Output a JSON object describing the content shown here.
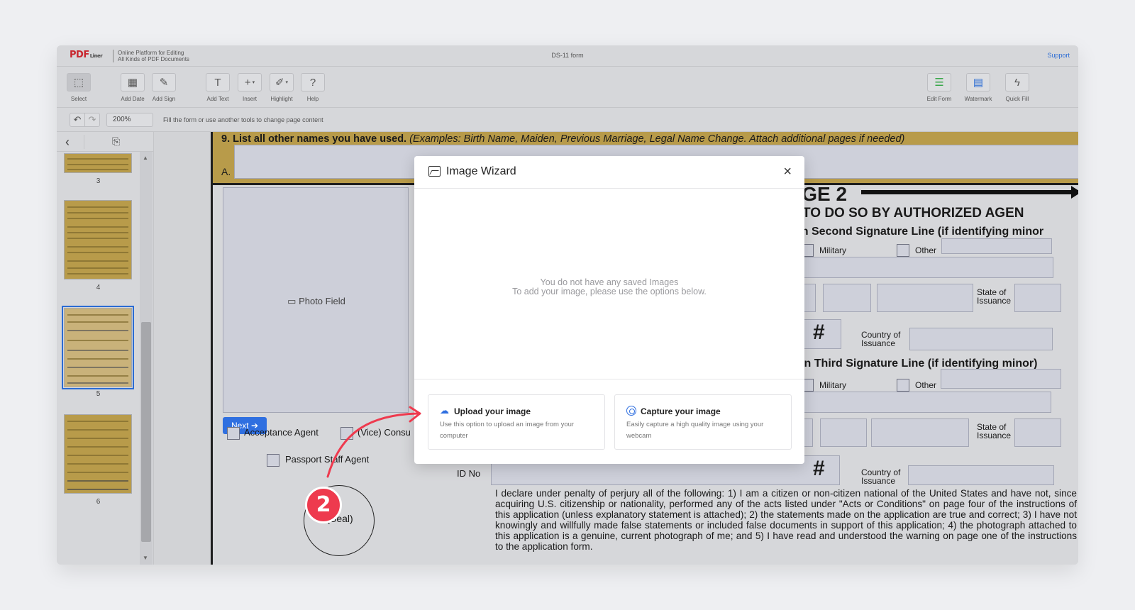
{
  "header": {
    "logo_main": "PDF",
    "logo_sub": "Liner",
    "tagline_line1": "Online Platform for Editing",
    "tagline_line2": "All Kinds of PDF Documents",
    "document_title": "DS-11 form",
    "support_link": "Support"
  },
  "toolbar": {
    "left_tools": [
      {
        "label": "Select",
        "icon": "select-cursor-icon"
      },
      {
        "label": "Add Date",
        "icon": "calendar-icon"
      },
      {
        "label": "Add Sign",
        "icon": "signature-pen-icon"
      },
      {
        "label": "Add Text",
        "icon": "text-t-icon"
      },
      {
        "label": "Insert",
        "icon": "plus-icon"
      },
      {
        "label": "Highlight",
        "icon": "highlighter-icon"
      },
      {
        "label": "Help",
        "icon": "question-icon"
      }
    ],
    "right_tools": [
      {
        "label": "Edit Form",
        "icon": "edit-form-icon"
      },
      {
        "label": "Watermark",
        "icon": "watermark-icon"
      },
      {
        "label": "Quick Fill",
        "icon": "lightning-icon"
      }
    ]
  },
  "subbar": {
    "zoom": "200%",
    "hint": "Fill the form or use another tools to change page content"
  },
  "sidebar": {
    "pages": [
      {
        "number": "3"
      },
      {
        "number": "4"
      },
      {
        "number": "5",
        "selected": true
      },
      {
        "number": "6"
      }
    ]
  },
  "document": {
    "q9_bold": "9.  List all other names you have used.",
    "q9_italic": " (Examples: Birth Name, Maiden, Previous Marriage, Legal Name Change.  Attach additional  pages if needed)",
    "row_a_label": "A.",
    "photo_field": "Photo Field",
    "next_button": "Next ➔",
    "acceptance_agent": "Acceptance Agent",
    "vice_consul": "(Vice) Consu",
    "passport_staff_agent": "Passport Staff Agent",
    "seal": "(Seal)",
    "page2_heading": "AGE 2",
    "authorized_agent": "D TO DO SO BY AUTHORIZED AGEN",
    "second_signature": "on Second Signature Line (if identifying minor",
    "third_signature": "t on Third Signature Line (if identifying minor)",
    "military": "Military",
    "other": "Other",
    "state_of_issuance_1": "State of",
    "state_of_issuance_2": "Issuance",
    "country_of_issuance_1": "Country of",
    "country_of_issuance_2": "Issuance",
    "id_no": "ID No",
    "hash": "#",
    "declaration": "I declare under penalty of perjury all of the following: 1) I am a citizen or non-citizen national of the United States and have not, since acquiring U.S. citizenship or nationality, performed any of the acts listed under \"Acts or Conditions\" on page four of the instructions of this application (unless explanatory statement is attached); 2) the statements made on the application are true and correct; 3) I have not knowingly and willfully made false statements or included false documents in support of this application; 4) the photograph attached to this application is a genuine, current photograph of me; and 5) I have read and understood the warning on page one of the instructions to the application form."
  },
  "modal": {
    "title": "Image Wizard",
    "empty_line1": "You do not have any saved Images",
    "empty_line2": "To add your image, please use the options below.",
    "upload_title": "Upload your image",
    "upload_desc": "Use this option to upload an image from your computer",
    "capture_title": "Capture your image",
    "capture_desc": "Easily capture a high quality image using your webcam"
  },
  "annotation": {
    "step_number": "2",
    "accent_color": "#ee3a4e"
  },
  "colors": {
    "brand_red": "#c8262e",
    "link_blue": "#2b6cd4",
    "primary_button": "#2f6fe0",
    "form_gold": "#b89b4a"
  }
}
